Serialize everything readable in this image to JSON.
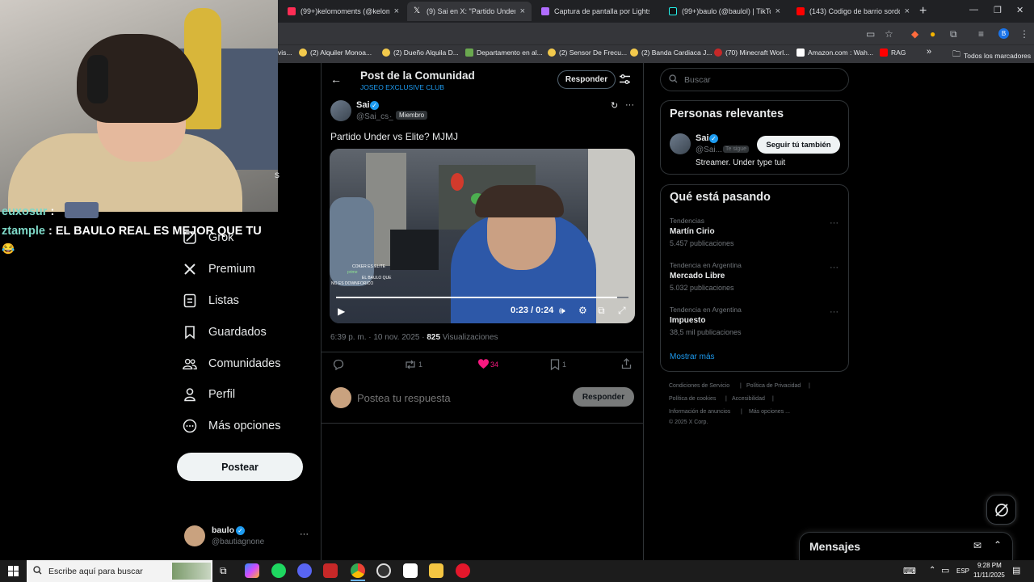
{
  "browser": {
    "tabs": [
      {
        "title": "(99+)kelomoments (@kelomon",
        "close": "×"
      },
      {
        "title": "(9) Sai en X: \"Partido Under vs I",
        "close": "×"
      },
      {
        "title": "Captura de pantalla por Lightsh",
        "close": "×"
      },
      {
        "title": "(99+)baulo (@baulol) | TikTok",
        "close": "×"
      },
      {
        "title": "(143) Codigo de barrio sordo r",
        "close": "×"
      }
    ],
    "new_tab": "+",
    "profile_letter": "B",
    "bookmarks": [
      "vis...",
      "(2) Alquiler Monoa...",
      "(2) Dueño Alquila D...",
      "Departamento en al...",
      "(2) Sensor De Frecu...",
      "(2) Banda Cardiaca J...",
      "(70) Minecraft Worl...",
      "Amazon.com : Wah...",
      "RAG",
      "Todos los marcadores"
    ],
    "bookmarks_overflow": "»"
  },
  "stream_chat": [
    {
      "user": "euxosur",
      "sep": " :",
      "message": ""
    },
    {
      "user": "ztample",
      "sep": " : ",
      "message": "EL BAULO REAL ES MEJOR QUE TU"
    }
  ],
  "stream_emoji": "😂",
  "stream_partial_letter": "s",
  "sidebar": {
    "items": [
      {
        "label": "Grok"
      },
      {
        "label": "Premium"
      },
      {
        "label": "Listas"
      },
      {
        "label": "Guardados"
      },
      {
        "label": "Comunidades"
      },
      {
        "label": "Perfil"
      },
      {
        "label": "Más opciones"
      }
    ],
    "post_button": "Postear",
    "account": {
      "name": "baulo",
      "handle": "@bautiagnone",
      "more": "···"
    }
  },
  "header": {
    "title": "Post de la Comunidad",
    "subtitle": "JOSEO EXCLUSIVE CLUB",
    "reply_button": "Responder"
  },
  "post": {
    "author_name": "Sai",
    "author_handle": "@Sai_cs_",
    "dot": "·",
    "badge": "Miembro",
    "more": "···",
    "text": "Partido Under vs Elite? MJMJ",
    "video": {
      "time": "0:23 / 0:24",
      "progress": 0.96,
      "overlay_lines": [
        "COKER ES ELITE",
        "prime",
        "EL BAULO QUE",
        "NO ES DOWNFORICO"
      ]
    },
    "meta_time": "6:39 p. m. · 10 nov. 2025 · ",
    "meta_views_count": "825",
    "meta_views_label": " Visualizaciones",
    "retweets": "1",
    "likes": "34",
    "bookmarks": "1"
  },
  "reply": {
    "placeholder": "Postea tu respuesta",
    "button": "Responder"
  },
  "right": {
    "search_placeholder": "Buscar",
    "relevant": {
      "title": "Personas relevantes",
      "name": "Sai",
      "handle": "@Sai...",
      "follows_you": "Te sigue",
      "follow_button": "Seguir tú también",
      "bio": "Streamer. Under type tuit"
    },
    "trends": {
      "title": "Qué está pasando",
      "items": [
        {
          "context": "Tendencias",
          "name": "Martín Cirio",
          "count": "5.457 publicaciones"
        },
        {
          "context": "Tendencia en Argentina",
          "name": "Mercado Libre",
          "count": "5.032 publicaciones"
        },
        {
          "context": "Tendencia en Argentina",
          "name": "Impuesto",
          "count": "38,5 mil publicaciones"
        }
      ],
      "more_dots": "···",
      "show_more": "Mostrar más"
    },
    "footer": {
      "line1": [
        "Condiciones de Servicio",
        "|",
        "Política de Privacidad",
        "|"
      ],
      "line2": [
        "Política de cookies",
        "|",
        "Accesibilidad",
        "|"
      ],
      "line3": [
        "Información de anuncios",
        "|",
        "Más opciones ..."
      ],
      "copyright": "© 2025 X Corp."
    }
  },
  "messages": {
    "title": "Mensajes"
  },
  "taskbar": {
    "search_placeholder": "Escribe aquí para buscar",
    "lang": "ESP",
    "time": "9:28 PM",
    "date": "11/11/2025"
  },
  "colors": {
    "accent_blue": "#1d9bf0",
    "like_pink": "#f91880",
    "chat_user": "#7ed8c7"
  }
}
